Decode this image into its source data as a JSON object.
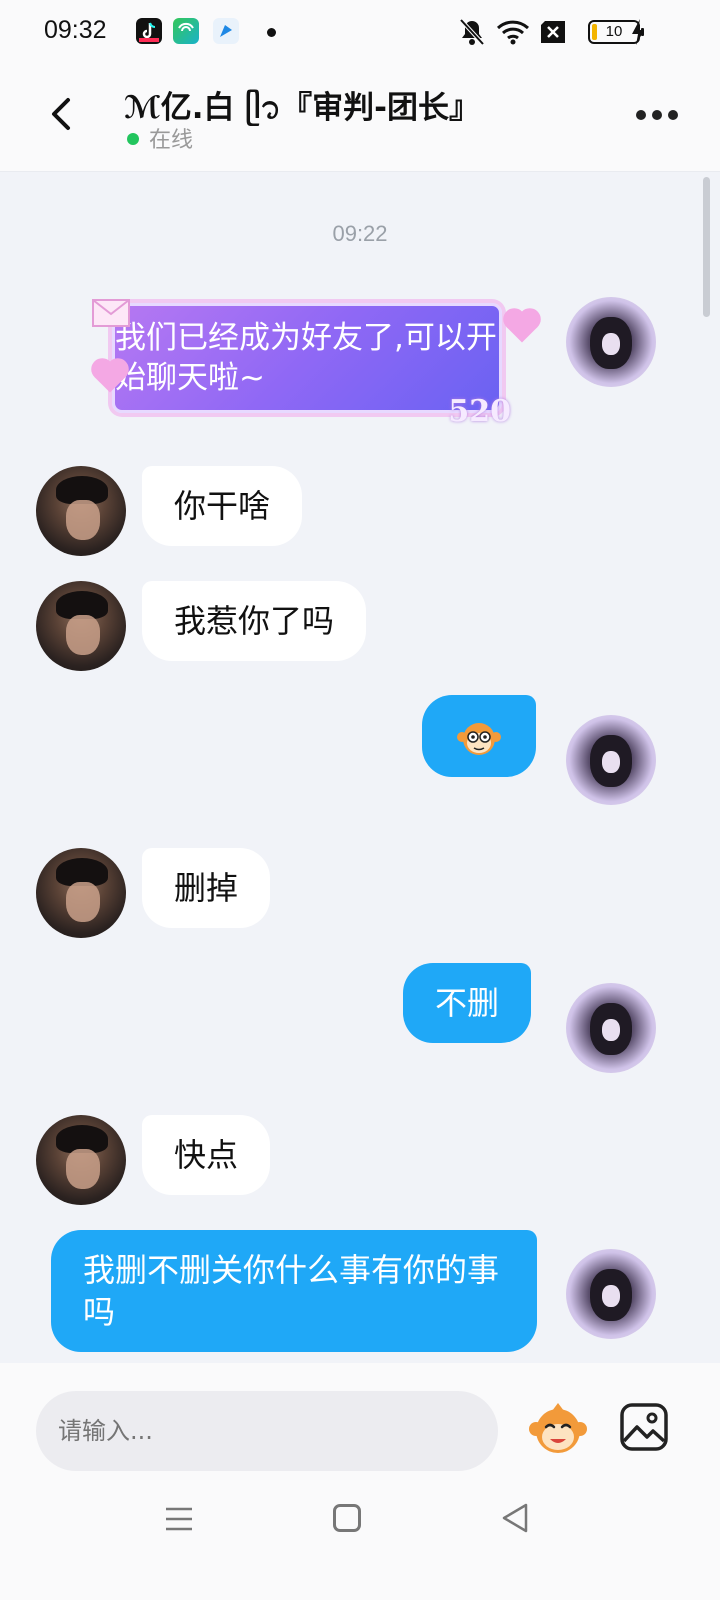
{
  "status_bar": {
    "time": "09:32",
    "battery": "10",
    "icons": [
      "tiktok-icon",
      "app-icon",
      "browser-icon",
      "notification-dot-icon",
      "mute-icon",
      "wifi-icon",
      "no-sim-icon",
      "battery-icon",
      "charging-icon"
    ]
  },
  "header": {
    "title": "ℳ亿.白 ᥫ᭡『审判-团长』",
    "status": "在线",
    "status_color": "#22c55e"
  },
  "chat": {
    "timestamp": "09:22",
    "system_message": "我们已经成为好友了,可以开始聊天啦~",
    "system_badge": "520",
    "messages": [
      {
        "side": "in",
        "text": "你干啥"
      },
      {
        "side": "in",
        "text": "我惹你了吗"
      },
      {
        "side": "out",
        "text": "",
        "sticker": "monkey-emoji"
      },
      {
        "side": "in",
        "text": "删掉"
      },
      {
        "side": "out",
        "text": "不删"
      },
      {
        "side": "in",
        "text": "快点"
      },
      {
        "side": "out",
        "text": "我删不删关你什么事有你的事吗"
      }
    ]
  },
  "input": {
    "placeholder": "请输入..."
  },
  "colors": {
    "outgoing_bubble": "#1fa8f7",
    "incoming_bubble": "#ffffff",
    "background": "#f1f3f8"
  }
}
